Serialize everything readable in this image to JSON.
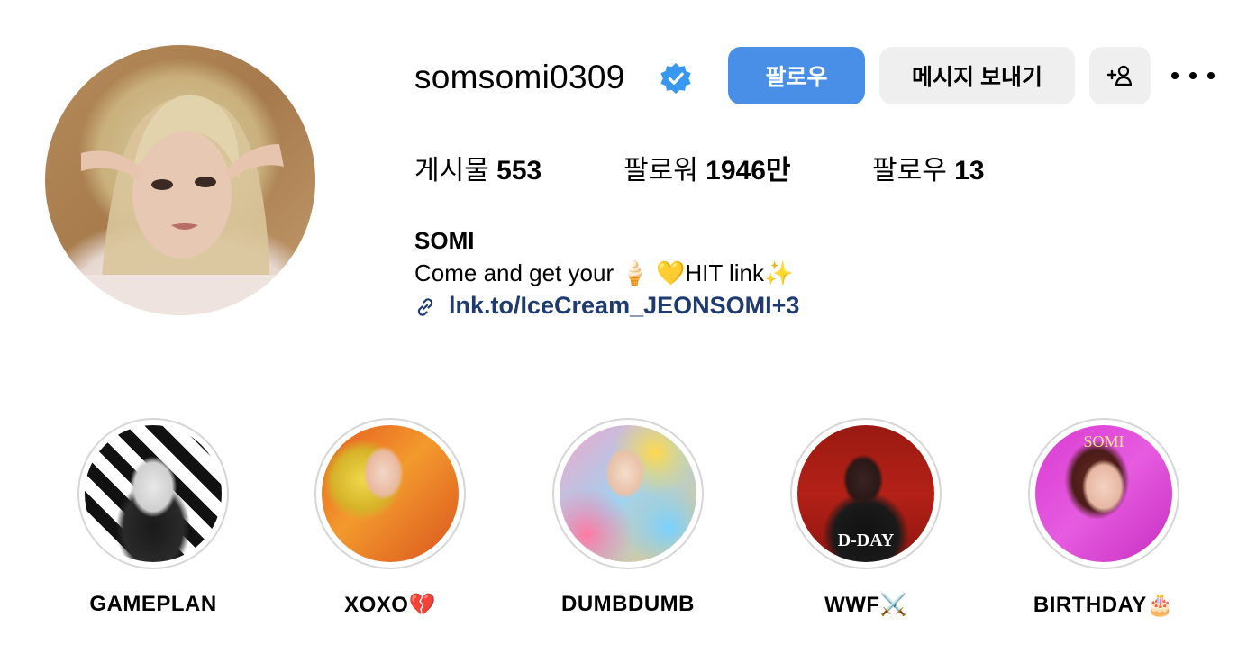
{
  "profile": {
    "username": "somsomi0309",
    "display_name": "SOMI",
    "bio": "Come and get your 🍦 💛HIT link✨",
    "link": "lnk.to/IceCream_JEONSOMI+3"
  },
  "buttons": {
    "follow": "팔로우",
    "message": "메시지 보내기",
    "suggest": "+♀"
  },
  "stats": {
    "posts_label": "게시물",
    "posts_value": "553",
    "followers_label": "팔로워",
    "followers_value": "1946만",
    "following_label": "팔로우",
    "following_value": "13"
  },
  "highlights": [
    {
      "label": "GAMEPLAN"
    },
    {
      "label": "XOXO💔"
    },
    {
      "label": "DUMBDUMB"
    },
    {
      "label": "WWF⚔️"
    },
    {
      "label": "BIRTHDAY🎂"
    }
  ],
  "highlight_overlays": {
    "wwf": "D-DAY",
    "birthday": "SOMI"
  },
  "colors": {
    "follow_button": "#4a8fe7",
    "secondary_button": "#efefef",
    "link": "#1e3a6e",
    "verified": "#3897f0"
  }
}
